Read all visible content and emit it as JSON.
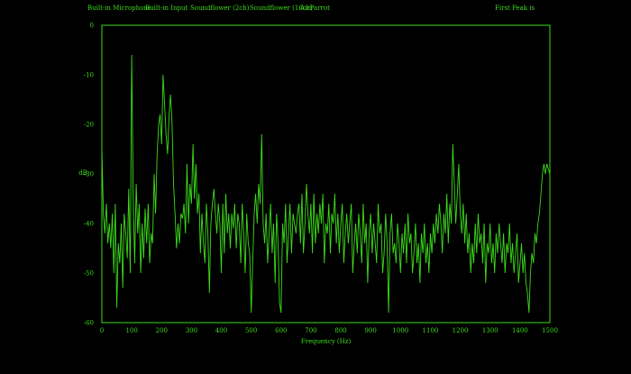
{
  "menu": {
    "items": [
      "Built-in Microphone",
      "Built-in Input",
      "Soundflower (2ch)",
      "Soundflower (16ch)",
      "AirParrot"
    ],
    "peak_label": "First Peak is"
  },
  "chart_data": {
    "type": "line",
    "xlabel": "Frequency (Hz)",
    "ylabel": "dB",
    "xlim": [
      0,
      1500
    ],
    "ylim": [
      -60,
      0
    ],
    "x_ticks": [
      0,
      100,
      200,
      300,
      400,
      500,
      600,
      700,
      800,
      900,
      1000,
      1100,
      1200,
      1300,
      1400,
      1500
    ],
    "y_ticks": [
      0,
      -10,
      -20,
      -30,
      -40,
      -50,
      -60
    ],
    "grid": false,
    "color": "#3cdc1a",
    "series": [
      {
        "x": [
          0,
          5,
          10,
          15,
          20,
          25,
          30,
          35,
          40,
          45,
          50,
          55,
          60,
          65,
          70,
          75,
          80,
          85,
          90,
          95,
          100,
          105,
          110,
          115,
          120,
          125,
          130,
          135,
          140,
          145,
          150,
          155,
          160,
          165,
          170,
          175,
          180,
          185,
          190,
          195,
          200,
          205,
          210,
          215,
          220,
          225,
          230,
          235,
          240,
          245,
          250,
          255,
          260,
          265,
          270,
          275,
          280,
          285,
          290,
          295,
          300,
          305,
          310,
          315,
          320,
          325,
          330,
          335,
          340,
          345,
          350,
          355,
          360,
          365,
          370,
          375,
          380,
          385,
          390,
          395,
          400,
          405,
          410,
          415,
          420,
          425,
          430,
          435,
          440,
          445,
          450,
          455,
          460,
          465,
          470,
          475,
          480,
          485,
          490,
          495,
          500,
          505,
          510,
          515,
          520,
          525,
          530,
          535,
          540,
          545,
          550,
          555,
          560,
          565,
          570,
          575,
          580,
          585,
          590,
          595,
          600,
          605,
          610,
          615,
          620,
          625,
          630,
          635,
          640,
          645,
          650,
          655,
          660,
          665,
          670,
          675,
          680,
          685,
          690,
          695,
          700,
          705,
          710,
          715,
          720,
          725,
          730,
          735,
          740,
          745,
          750,
          755,
          760,
          765,
          770,
          775,
          780,
          785,
          790,
          795,
          800,
          805,
          810,
          815,
          820,
          825,
          830,
          835,
          840,
          845,
          850,
          855,
          860,
          865,
          870,
          875,
          880,
          885,
          890,
          895,
          900,
          905,
          910,
          915,
          920,
          925,
          930,
          935,
          940,
          945,
          950,
          955,
          960,
          965,
          970,
          975,
          980,
          985,
          990,
          995,
          1000,
          1005,
          1010,
          1015,
          1020,
          1025,
          1030,
          1035,
          1040,
          1045,
          1050,
          1055,
          1060,
          1065,
          1070,
          1075,
          1080,
          1085,
          1090,
          1095,
          1100,
          1105,
          1110,
          1115,
          1120,
          1125,
          1130,
          1135,
          1140,
          1145,
          1150,
          1155,
          1160,
          1165,
          1170,
          1175,
          1180,
          1185,
          1190,
          1195,
          1200,
          1205,
          1210,
          1215,
          1220,
          1225,
          1230,
          1235,
          1240,
          1245,
          1250,
          1255,
          1260,
          1265,
          1270,
          1275,
          1280,
          1285,
          1290,
          1295,
          1300,
          1305,
          1310,
          1315,
          1320,
          1325,
          1330,
          1335,
          1340,
          1345,
          1350,
          1355,
          1360,
          1365,
          1370,
          1375,
          1380,
          1385,
          1390,
          1395,
          1400,
          1405,
          1410,
          1415,
          1420,
          1425,
          1430,
          1435,
          1440,
          1445,
          1450,
          1455,
          1460,
          1465,
          1470,
          1475,
          1480,
          1485,
          1490,
          1495,
          1500
        ],
        "y": [
          -25,
          -38,
          -42,
          -36,
          -44,
          -40,
          -45,
          -38,
          -50,
          -36,
          -57,
          -44,
          -48,
          -40,
          -53,
          -38,
          -42,
          -47,
          -33,
          -50,
          -6,
          -35,
          -48,
          -32,
          -42,
          -36,
          -50,
          -40,
          -47,
          -37,
          -44,
          -36,
          -48,
          -42,
          -44,
          -30,
          -38,
          -26,
          -20,
          -18,
          -24,
          -10,
          -16,
          -22,
          -26,
          -18,
          -14,
          -20,
          -32,
          -38,
          -45,
          -40,
          -44,
          -38,
          -39,
          -36,
          -42,
          -28,
          -40,
          -32,
          -36,
          -24,
          -35,
          -28,
          -38,
          -34,
          -46,
          -38,
          -44,
          -48,
          -36,
          -42,
          -54,
          -40,
          -36,
          -33,
          -38,
          -42,
          -36,
          -40,
          -50,
          -36,
          -46,
          -34,
          -42,
          -38,
          -45,
          -38,
          -41,
          -36,
          -45,
          -38,
          -40,
          -48,
          -36,
          -42,
          -50,
          -38,
          -44,
          -46,
          -58,
          -48,
          -38,
          -34,
          -40,
          -32,
          -36,
          -22,
          -40,
          -44,
          -38,
          -48,
          -42,
          -36,
          -46,
          -40,
          -52,
          -38,
          -44,
          -56,
          -58,
          -40,
          -44,
          -36,
          -48,
          -42,
          -36,
          -46,
          -38,
          -40,
          -42,
          -38,
          -36,
          -44,
          -34,
          -46,
          -40,
          -32,
          -38,
          -42,
          -36,
          -46,
          -34,
          -44,
          -38,
          -42,
          -36,
          -40,
          -34,
          -48,
          -40,
          -42,
          -36,
          -46,
          -38,
          -40,
          -34,
          -44,
          -38,
          -46,
          -40,
          -36,
          -48,
          -42,
          -38,
          -44,
          -40,
          -36,
          -50,
          -44,
          -40,
          -46,
          -38,
          -42,
          -48,
          -36,
          -44,
          -40,
          -52,
          -42,
          -38,
          -46,
          -40,
          -44,
          -48,
          -36,
          -42,
          -40,
          -50,
          -46,
          -38,
          -44,
          -58,
          -42,
          -38,
          -46,
          -44,
          -48,
          -40,
          -44,
          -50,
          -42,
          -46,
          -40,
          -48,
          -38,
          -44,
          -42,
          -50,
          -46,
          -40,
          -48,
          -44,
          -52,
          -42,
          -46,
          -40,
          -48,
          -44,
          -50,
          -42,
          -46,
          -40,
          -44,
          -38,
          -42,
          -36,
          -40,
          -46,
          -38,
          -42,
          -34,
          -44,
          -36,
          -40,
          -24,
          -32,
          -40,
          -34,
          -28,
          -38,
          -42,
          -36,
          -44,
          -38,
          -46,
          -42,
          -50,
          -44,
          -48,
          -40,
          -46,
          -38,
          -44,
          -42,
          -48,
          -40,
          -52,
          -44,
          -46,
          -40,
          -48,
          -44,
          -50,
          -42,
          -46,
          -40,
          -44,
          -48,
          -42,
          -50,
          -44,
          -46,
          -40,
          -48,
          -44,
          -50,
          -46,
          -42,
          -52,
          -48,
          -44,
          -50,
          -46,
          -52,
          -54,
          -58,
          -50,
          -46,
          -48,
          -42,
          -44,
          -40,
          -38,
          -34,
          -30,
          -28,
          -30,
          -28,
          -29,
          -30
        ]
      }
    ]
  }
}
